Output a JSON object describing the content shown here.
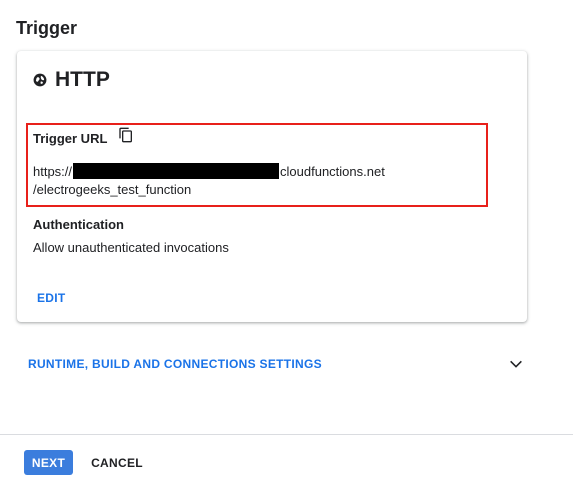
{
  "section": {
    "title": "Trigger"
  },
  "trigger_card": {
    "type_label": "HTTP",
    "type_icon": "globe-icon",
    "url_label": "Trigger URL",
    "copy_icon": "copy-icon",
    "url_prefix": "https://",
    "url_suffix": "cloudfunctions.net",
    "url_path": "/electrogeeks_test_function",
    "auth_label": "Authentication",
    "auth_value": "Allow unauthenticated invocations",
    "edit_label": "EDIT"
  },
  "expandable": {
    "label": "RUNTIME, BUILD AND CONNECTIONS SETTINGS",
    "icon": "chevron-down-icon"
  },
  "footer": {
    "next_label": "NEXT",
    "cancel_label": "CANCEL"
  },
  "colors": {
    "accent": "#1a73e8",
    "primary_button": "#3b7ddd",
    "highlight": "#e8201a",
    "text": "#202124"
  }
}
